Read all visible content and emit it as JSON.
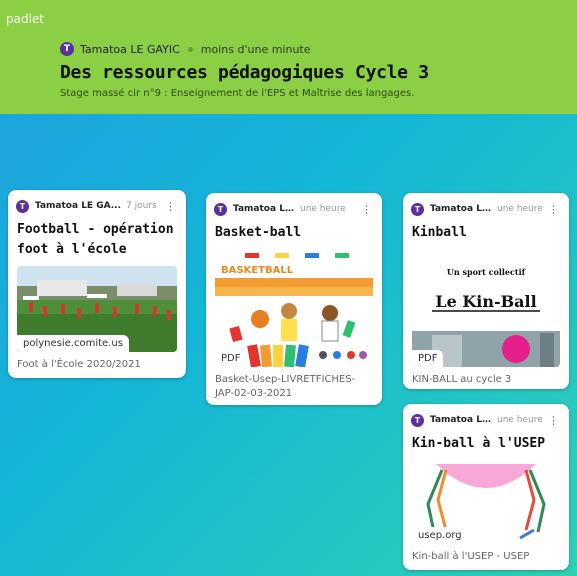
{
  "app": {
    "brand": "padlet"
  },
  "header": {
    "avatar_letter": "T",
    "author": "Tamatoa LE GAYIC",
    "time": "moins d'une minute",
    "title": "Des ressources pédagogiques Cycle 3",
    "subtitle": "Stage massé cir n°9 : Enseignement de l'EPS et Maîtrise des langages."
  },
  "colors": {
    "header_bg": "#8bcf45",
    "avatar": "#5b2fa0",
    "wall_from": "#1f9fe0",
    "wall_to": "#2fd0b4"
  },
  "cards": [
    {
      "avatar_letter": "T",
      "author": "Tamatoa LE GA...",
      "time": "7 jours",
      "title": "Football - opération foot à l'école",
      "link_badge": "polynesie.comite.us",
      "caption": "Foot à l'École 2020/2021"
    },
    {
      "avatar_letter": "T",
      "author": "Tamatoa LE ...",
      "time": "une heure",
      "title": "Basket-ball",
      "thumb_heading": "BASKETBALL",
      "file_badge": "PDF",
      "caption": "Basket-Usep-LIVRETFICHES-JAP-02-03-2021"
    },
    {
      "avatar_letter": "T",
      "author": "Tamatoa LE ...",
      "time": "une heure",
      "title": "Kinball",
      "thumb_line1": "Un sport collectif",
      "thumb_line2": "Le Kin-Ball",
      "file_badge": "PDF",
      "caption": "KIN-BALL au cycle 3"
    },
    {
      "avatar_letter": "T",
      "author": "Tamatoa LE ...",
      "time": "une heure",
      "title": "Kin-ball à l'USEP",
      "link_badge": "usep.org",
      "caption": "Kin-ball à l'USEP - USEP"
    }
  ]
}
